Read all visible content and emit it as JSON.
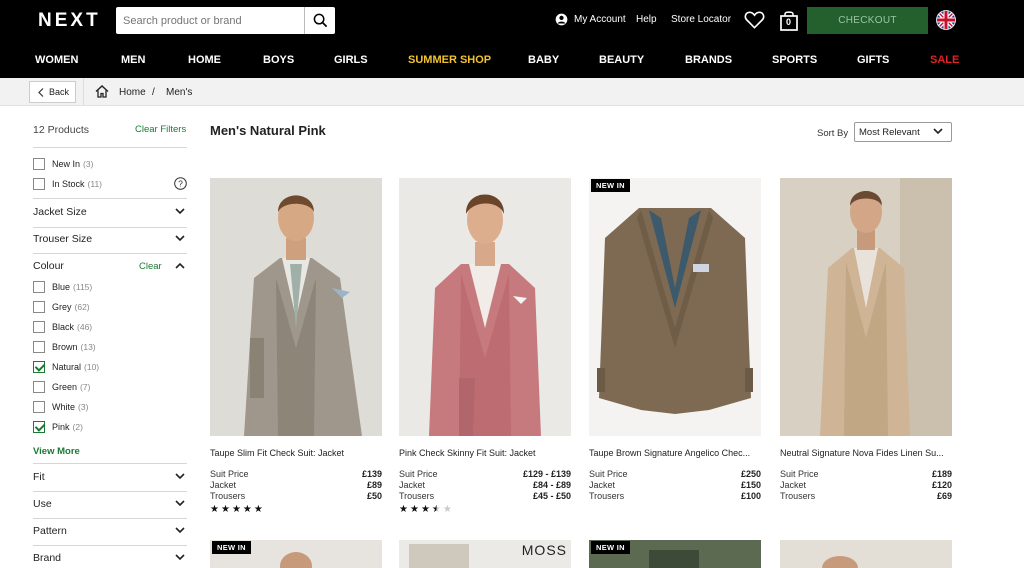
{
  "header": {
    "logo": "NEXT",
    "search_placeholder": "Search product or brand",
    "my_account": "My Account",
    "help": "Help",
    "store_locator": "Store Locator",
    "bag_count": "0",
    "checkout": "CHECKOUT"
  },
  "nav": [
    {
      "label": "WOMEN",
      "color": "#ffffff"
    },
    {
      "label": "MEN",
      "color": "#ffffff"
    },
    {
      "label": "HOME",
      "color": "#ffffff"
    },
    {
      "label": "BOYS",
      "color": "#ffffff"
    },
    {
      "label": "GIRLS",
      "color": "#ffffff"
    },
    {
      "label": "SUMMER SHOP",
      "color": "#f2c230"
    },
    {
      "label": "BABY",
      "color": "#ffffff"
    },
    {
      "label": "BEAUTY",
      "color": "#ffffff"
    },
    {
      "label": "BRANDS",
      "color": "#ffffff"
    },
    {
      "label": "SPORTS",
      "color": "#ffffff"
    },
    {
      "label": "GIFTS",
      "color": "#ffffff"
    },
    {
      "label": "SALE",
      "color": "#e02323"
    }
  ],
  "breadcrumb": {
    "back": "Back",
    "home": "Home",
    "separator": "/",
    "current": "Men's"
  },
  "sidebar": {
    "count": "12 Products",
    "clear_filters": "Clear Filters",
    "quick_filters": [
      {
        "label": "New In",
        "count": "(3)",
        "checked": false
      },
      {
        "label": "In Stock",
        "count": "(11)",
        "checked": false
      }
    ],
    "facets_top": [
      "Jacket Size",
      "Trouser Size"
    ],
    "colour": {
      "title": "Colour",
      "clear": "Clear",
      "options": [
        {
          "label": "Blue",
          "count": "(115)",
          "checked": false
        },
        {
          "label": "Grey",
          "count": "(62)",
          "checked": false
        },
        {
          "label": "Black",
          "count": "(46)",
          "checked": false
        },
        {
          "label": "Brown",
          "count": "(13)",
          "checked": false
        },
        {
          "label": "Natural",
          "count": "(10)",
          "checked": true
        },
        {
          "label": "Green",
          "count": "(7)",
          "checked": false
        },
        {
          "label": "White",
          "count": "(3)",
          "checked": false
        },
        {
          "label": "Pink",
          "count": "(2)",
          "checked": true
        }
      ],
      "view_more": "View More"
    },
    "facets_bottom": [
      "Fit",
      "Use",
      "Pattern",
      "Brand"
    ]
  },
  "main": {
    "title": "Men's Natural Pink",
    "sort_label": "Sort By",
    "sort_value": "Most Relevant"
  },
  "products": [
    {
      "name": "Taupe Slim Fit Check Suit: Jacket",
      "badge": "",
      "prices": [
        {
          "label": "Suit Price",
          "value": "£139"
        },
        {
          "label": "Jacket",
          "value": "£89"
        },
        {
          "label": "Trousers",
          "value": "£50"
        }
      ],
      "rating": 5
    },
    {
      "name": "Pink Check Skinny Fit Suit: Jacket",
      "badge": "",
      "prices": [
        {
          "label": "Suit Price",
          "value": "£129 - £139"
        },
        {
          "label": "Jacket",
          "value": "£84 - £89"
        },
        {
          "label": "Trousers",
          "value": "£45 - £50"
        }
      ],
      "rating": 3.5
    },
    {
      "name": "Taupe Brown Signature Angelico Chec...",
      "badge": "NEW IN",
      "prices": [
        {
          "label": "Suit Price",
          "value": "£250"
        },
        {
          "label": "Jacket",
          "value": "£150"
        },
        {
          "label": "Trousers",
          "value": "£100"
        }
      ],
      "rating": null
    },
    {
      "name": "Neutral Signature Nova Fides Linen Su...",
      "badge": "",
      "prices": [
        {
          "label": "Suit Price",
          "value": "£189"
        },
        {
          "label": "Jacket",
          "value": "£120"
        },
        {
          "label": "Trousers",
          "value": "£69"
        }
      ],
      "rating": null
    }
  ],
  "row2": {
    "badge_1": "NEW IN",
    "brand_2": "MOSS",
    "badge_3": "NEW IN"
  },
  "colors": {
    "accent_green": "#1a7a33",
    "checkout_bg": "#23602e",
    "sale_red": "#e02323",
    "summer_yellow": "#f2c230"
  }
}
